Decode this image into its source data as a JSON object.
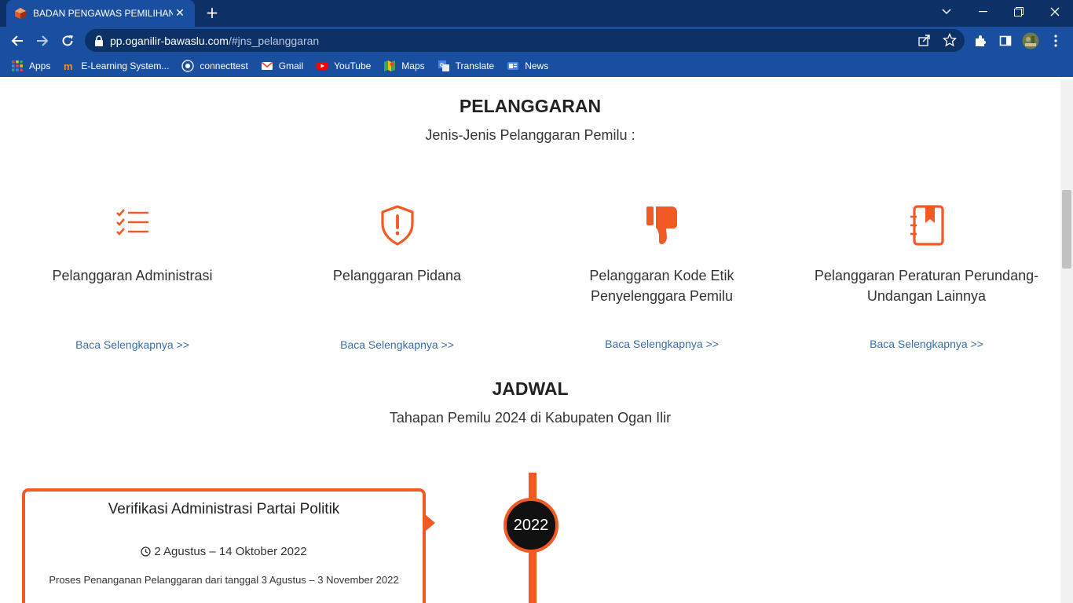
{
  "browser": {
    "tab_title": "BADAN PENGAWAS PEMILIHAN UMUM",
    "url_host": "pp.oganilir-bawaslu.com",
    "url_path": "/#jns_pelanggaran"
  },
  "bookmarks": [
    {
      "label": "Apps",
      "icon": "apps-grid-icon"
    },
    {
      "label": "E-Learning System...",
      "icon": "elearning-icon"
    },
    {
      "label": "connecttest",
      "icon": "connecttest-icon"
    },
    {
      "label": "Gmail",
      "icon": "gmail-icon"
    },
    {
      "label": "YouTube",
      "icon": "youtube-icon"
    },
    {
      "label": "Maps",
      "icon": "maps-icon"
    },
    {
      "label": "Translate",
      "icon": "translate-icon"
    },
    {
      "label": "News",
      "icon": "news-icon"
    }
  ],
  "pelanggaran": {
    "title": "PELANGGARAN",
    "subtitle": "Jenis-Jenis Pelanggaran Pemilu :",
    "items": [
      {
        "label_line1": "Pelanggaran Administrasi",
        "label_line2": "",
        "link": "Baca Selengkapnya >>",
        "icon": "checklist-icon"
      },
      {
        "label_line1": "Pelanggaran Pidana",
        "label_line2": "",
        "link": "Baca Selengkapnya >>",
        "icon": "shield-alert-icon"
      },
      {
        "label_line1": "Pelanggaran Kode Etik",
        "label_line2": "Penyelenggara Pemilu",
        "link": "Baca Selengkapnya >>",
        "icon": "thumbs-down-icon"
      },
      {
        "label_line1": "Pelanggaran Peraturan Perundang-",
        "label_line2": "Undangan Lainnya",
        "link": "Baca Selengkapnya >>",
        "icon": "law-book-icon"
      }
    ]
  },
  "jadwal": {
    "title": "JADWAL",
    "subtitle": "Tahapan Pemilu 2024 di Kabupaten Ogan Ilir",
    "year": "2022",
    "card": {
      "title": "Verifikasi Administrasi Partai Politik",
      "date": "2 Agustus – 14 Oktober 2022",
      "desc": "Proses Penanganan Pelanggaran dari tanggal 3 Agustus – 3 November 2022"
    }
  },
  "colors": {
    "accent": "#f15a24",
    "chrome_dark": "#0b3166",
    "chrome": "#1a4fa0",
    "link": "#3a6ea5"
  }
}
